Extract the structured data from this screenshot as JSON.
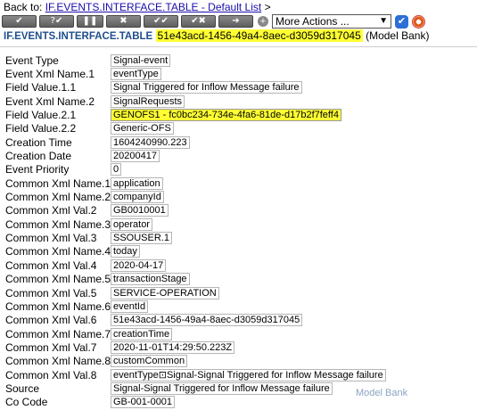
{
  "back": {
    "prefix": "Back to:",
    "link": "IF.EVENTS.INTERFACE.TABLE - Default List",
    "suffix": ">"
  },
  "toolbar": {
    "buttons": [
      {
        "name": "commit-button",
        "glyph": "✔"
      },
      {
        "name": "validate-button",
        "glyph": "?✔"
      },
      {
        "name": "hold-button",
        "glyph": "❚❚"
      },
      {
        "name": "delete-button",
        "glyph": "✖"
      },
      {
        "name": "authorise-button",
        "glyph": "✔✔"
      },
      {
        "name": "reverse-button",
        "glyph": "✔✖"
      },
      {
        "name": "next-button",
        "glyph": "➔"
      }
    ],
    "more_actions": "More Actions ...",
    "plus_icon": "+",
    "go_icon": "✔"
  },
  "header": {
    "table": "IF.EVENTS.INTERFACE.TABLE",
    "record_id": "51e43acd-1456-49a4-8aec-d3059d317045",
    "company": "(Model Bank)"
  },
  "fields": [
    {
      "label": "Event Type",
      "value": "Signal-event"
    },
    {
      "label": "Event Xml Name.1",
      "value": "eventType"
    },
    {
      "label": "Field Value.1.1",
      "value": "Signal Triggered for Inflow Message failure"
    },
    {
      "label": "Event Xml Name.2",
      "value": "SignalRequests"
    },
    {
      "label": "Field Value.2.1",
      "value": "GENOFS1 - fc0bc234-734e-4fa6-81de-d17b2f7feff4",
      "highlight": true
    },
    {
      "label": "Field Value.2.2",
      "value": "Generic-OFS"
    },
    {
      "label": "Creation Time",
      "value": "1604240990.223"
    },
    {
      "label": "Creation Date",
      "value": "20200417"
    },
    {
      "label": "Event Priority",
      "value": "0"
    },
    {
      "label": "Common Xml Name.1",
      "value": "application"
    },
    {
      "label": "Common Xml Name.2",
      "value": "companyId"
    },
    {
      "label": "Common Xml Val.2",
      "value": "GB0010001"
    },
    {
      "label": "Common Xml Name.3",
      "value": "operator"
    },
    {
      "label": "Common Xml Val.3",
      "value": "SSOUSER.1"
    },
    {
      "label": "Common Xml Name.4",
      "value": "today"
    },
    {
      "label": "Common Xml Val.4",
      "value": "2020-04-17"
    },
    {
      "label": "Common Xml Name.5",
      "value": "transactionStage"
    },
    {
      "label": "Common Xml Val.5",
      "value": "SERVICE-OPERATION"
    },
    {
      "label": "Common Xml Name.6",
      "value": "eventId"
    },
    {
      "label": "Common Xml Val.6",
      "value": "51e43acd-1456-49a4-8aec-d3059d317045"
    },
    {
      "label": "Common Xml Name.7",
      "value": "creationTime"
    },
    {
      "label": "Common Xml Val.7",
      "value": "2020-11-01T14:29:50.223Z"
    },
    {
      "label": "Common Xml Name.8",
      "value": "customCommon"
    },
    {
      "label": "Common Xml Val.8",
      "value": "eventType⊡Signal-Signal Triggered for Inflow Message failure"
    },
    {
      "label": "Source",
      "value": "Signal-Signal Triggered for Inflow Message failure"
    },
    {
      "label": "Co Code",
      "value": "GB-001-0001"
    }
  ],
  "brand": "Model Bank",
  "colors": {
    "highlight": "#ffff33",
    "link": "#1a0dab",
    "table_name": "#1f4e8c"
  }
}
